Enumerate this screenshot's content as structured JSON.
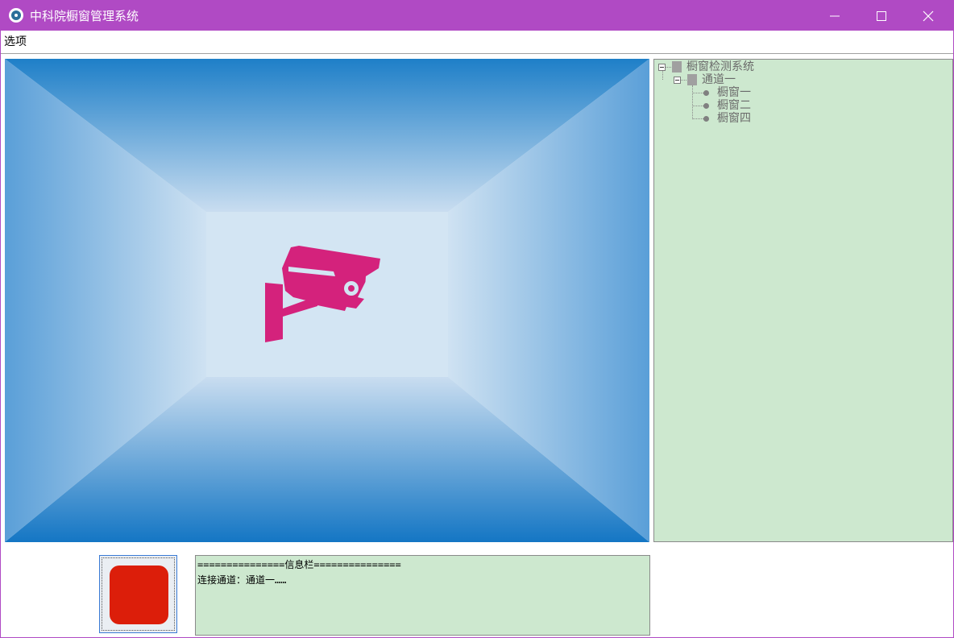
{
  "window": {
    "title": "中科院橱窗管理系统",
    "controls": {
      "minimize": "minimize-icon",
      "maximize": "maximize-icon",
      "close": "close-icon"
    }
  },
  "menubar": {
    "items": [
      {
        "label": "选项"
      }
    ]
  },
  "video": {
    "icon": "surveillance-camera-icon",
    "icon_color": "#d4227c"
  },
  "tree": {
    "root": {
      "label": "橱窗检测系统",
      "children": [
        {
          "label": "通道一",
          "children": [
            {
              "label": "橱窗一"
            },
            {
              "label": "橱窗二"
            },
            {
              "label": "橱窗四"
            }
          ]
        }
      ]
    }
  },
  "status_indicator": {
    "color": "#dc1e0a"
  },
  "info_panel": {
    "header": "===============信息栏===============",
    "lines": [
      "连接通道：通道一……"
    ]
  },
  "colors": {
    "titlebar": "#b04ac4",
    "panel_background": "#cde8cf"
  }
}
